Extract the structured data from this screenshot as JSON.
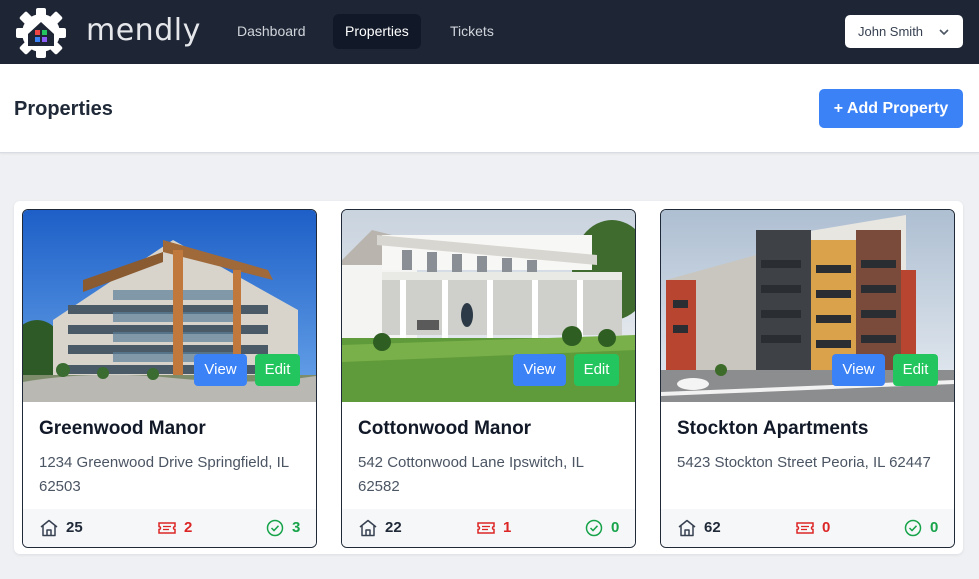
{
  "app": {
    "brand": "mendly",
    "nav": [
      {
        "label": "Dashboard",
        "active": false
      },
      {
        "label": "Properties",
        "active": true
      },
      {
        "label": "Tickets",
        "active": false
      }
    ],
    "user": {
      "name": "John Smith",
      "icon": "chevron-down-icon"
    }
  },
  "header": {
    "title": "Properties",
    "add_button": "+ Add Property"
  },
  "colors": {
    "nav_bg": "#1e2535",
    "primary": "#3b82f6",
    "success": "#22c55e",
    "danger": "#dc2626"
  },
  "properties": [
    {
      "name": "Greenwood Manor",
      "address": "1234 Greenwood Drive Springfield, IL 62503",
      "units": "25",
      "open_tickets": "2",
      "resolved": "3",
      "view_label": "View",
      "edit_label": "Edit"
    },
    {
      "name": "Cottonwood Manor",
      "address": "542 Cottonwood Lane Ipswitch, IL 62582",
      "units": "22",
      "open_tickets": "1",
      "resolved": "0",
      "view_label": "View",
      "edit_label": "Edit"
    },
    {
      "name": "Stockton Apartments",
      "address": "5423 Stockton Street Peoria, IL 62447",
      "units": "62",
      "open_tickets": "0",
      "resolved": "0",
      "view_label": "View",
      "edit_label": "Edit"
    }
  ]
}
